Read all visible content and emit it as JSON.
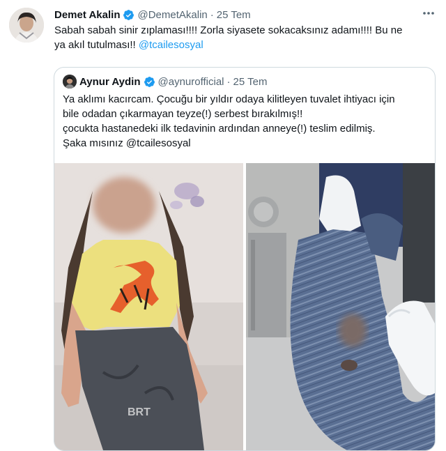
{
  "tweet": {
    "author_name": "Demet Akalin",
    "handle": "@DemetAkalin",
    "separator": "·",
    "date": "25 Tem",
    "more_icon": "more-horizontal-icon",
    "text_line1": "Sabah sabah sinir zıplaması!!!! Zorla siyasete sokacaksınız adamı!!!! Bu ne",
    "text_line2_prefix": "ya akıl tutulması!! ",
    "mention": "@tcailesosyal"
  },
  "quoted": {
    "author_name": "Aynur Aydin",
    "handle": "@aynurofficial",
    "separator": "·",
    "date": "25 Tem",
    "lines": [
      "Ya aklımı kacırcam. Çocuğu bir yıldır odaya kilitleyen tuvalet ihtiyacı için",
      "bile odadan çıkarmayan teyze(!) serbest bırakılmış!!",
      "çocukta hastanedeki ilk tedavinin ardından anneye(!) teslim edilmiş.",
      "Şaka mısınız @tcailesosyal"
    ],
    "image_watermark": "BRT"
  },
  "colors": {
    "text": "#0f1419",
    "muted": "#536471",
    "accent": "#1d9bf0",
    "border": "#cfd9de"
  }
}
